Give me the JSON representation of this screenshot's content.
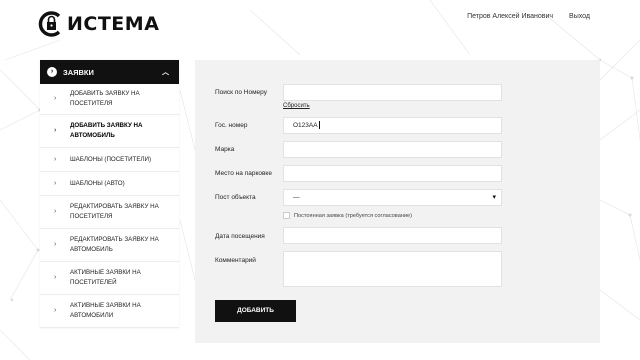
{
  "brand": {
    "logo_text": "ИСТЕМА",
    "logo_letter": "С"
  },
  "user_nav": {
    "user_name": "Петров Алексей Иванович",
    "logout": "Выход"
  },
  "sidebar": {
    "header": "ЗАЯВКИ",
    "items": [
      {
        "label": "ДОБАВИТЬ ЗАЯВКУ НА ПОСЕТИТЕЛЯ",
        "active": false
      },
      {
        "label": "ДОБАВИТЬ ЗАЯВКУ НА АВТОМОБИЛЬ",
        "active": true
      },
      {
        "label": "ШАБЛОНЫ (ПОСЕТИТЕЛИ)",
        "active": false
      },
      {
        "label": "ШАБЛОНЫ (АВТО)",
        "active": false
      },
      {
        "label": "РЕДАКТИРОВАТЬ ЗАЯВКУ НА ПОСЕТИТЕЛЯ",
        "active": false
      },
      {
        "label": "РЕДАКТИРОВАТЬ ЗАЯВКУ НА АВТОМОБИЛЬ",
        "active": false
      },
      {
        "label": "АКТИВНЫЕ ЗАЯВКИ НА ПОСЕТИТЕЛЕЙ",
        "active": false
      },
      {
        "label": "АКТИВНЫЕ ЗАЯВКИ НА АВТОМОБИЛИ",
        "active": false
      }
    ]
  },
  "form": {
    "search_label": "Поиск по Номеру",
    "search_value": "",
    "reset_link": "Сбросить",
    "plate_label": "Гос. номер",
    "plate_value": "О123АА",
    "brand_label": "Марка",
    "brand_value": "",
    "parking_label": "Место на парковке",
    "parking_value": "",
    "post_label": "Пост объекта",
    "post_value": "—",
    "permanent_label": "Постоянная заявка (требуется согласование)",
    "permanent_checked": false,
    "visit_date_label": "Дата посещения",
    "visit_date_value": "",
    "comment_label": "Комментарий",
    "comment_value": "",
    "submit_label": "ДОБАВИТЬ"
  },
  "colors": {
    "accent": "#111111",
    "panel_bg": "#f2f2f2",
    "page_bg": "#ffffff"
  }
}
